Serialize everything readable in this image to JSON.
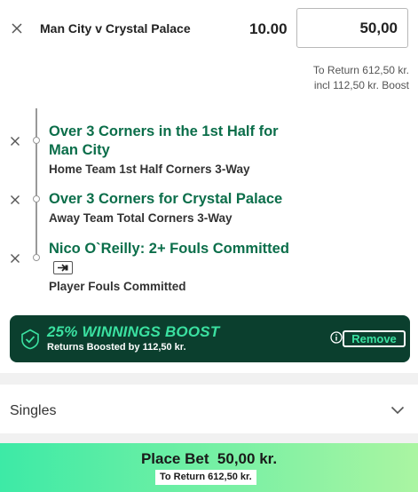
{
  "bet": {
    "match": "Man City v Crystal Palace",
    "odds": "10.00",
    "stake": "50,00",
    "to_return": "To Return 612,50 kr.",
    "boost_incl": "incl 112,50 kr. Boost"
  },
  "legs": [
    {
      "title_line1": "Over 3 Corners in the 1st Half for",
      "title_line2": "Man City",
      "market": "Home Team 1st Half Corners 3-Way"
    },
    {
      "title": "Over 3 Corners for Crystal Palace",
      "market": "Away Team Total Corners 3-Way"
    },
    {
      "title": "Nico O`Reilly: 2+ Fouls Committed",
      "market": "Player Fouls Committed"
    }
  ],
  "boost": {
    "title": "25% WINNINGS BOOST",
    "subtitle": "Returns Boosted by 112,50 kr.",
    "remove_label": "Remove"
  },
  "singles": {
    "label": "Singles"
  },
  "place_bet": {
    "label": "Place Bet  50,00 kr.",
    "to_return": "To Return 612,50 kr."
  },
  "colors": {
    "accent_green": "#0b6e4a",
    "boost_bg": "#0b3f2e",
    "boost_text": "#3be1a1"
  }
}
